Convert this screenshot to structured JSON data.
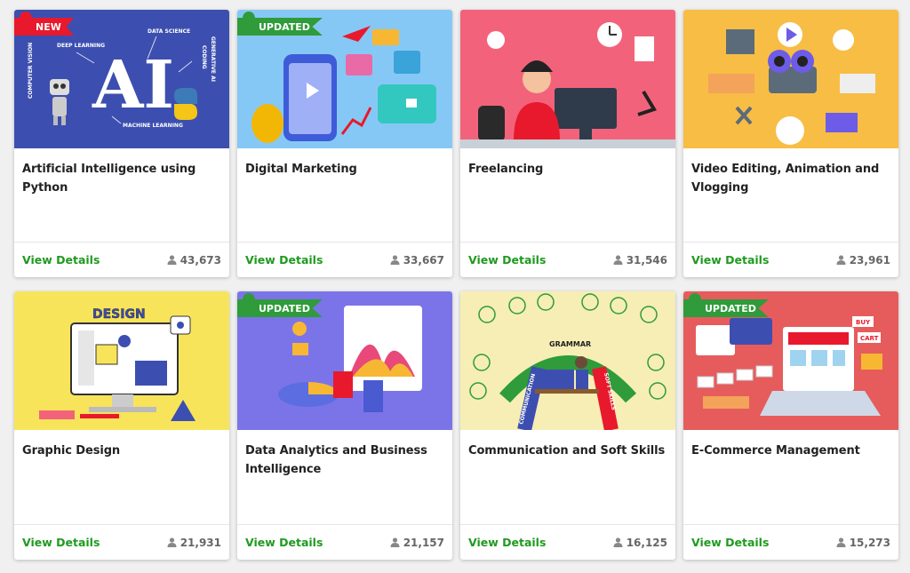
{
  "courses": [
    {
      "title": "Artificial Intelligence using Python",
      "details": "View Details",
      "count": "43,673",
      "badge": "NEW",
      "badge_color": "#e8192c",
      "thumb_bg": "#3c4fb0"
    },
    {
      "title": "Digital Marketing",
      "details": "View Details",
      "count": "33,667",
      "badge": "UPDATED",
      "badge_color": "#2f9b3a",
      "thumb_bg": "#86c8f5"
    },
    {
      "title": "Freelancing",
      "details": "View Details",
      "count": "31,546",
      "badge": "",
      "badge_color": "",
      "thumb_bg": "#f2637b"
    },
    {
      "title": "Video Editing, Animation and Vlogging",
      "details": "View Details",
      "count": "23,961",
      "badge": "",
      "badge_color": "",
      "thumb_bg": "#f7bd45"
    },
    {
      "title": "Graphic Design",
      "details": "View Details",
      "count": "21,931",
      "badge": "",
      "badge_color": "",
      "thumb_bg": "#f8e45a"
    },
    {
      "title": "Data Analytics and Business Intelligence",
      "details": "View Details",
      "count": "21,157",
      "badge": "UPDATED",
      "badge_color": "#2f9b3a",
      "thumb_bg": "#7b74e9"
    },
    {
      "title": "Communication and Soft Skills",
      "details": "View Details",
      "count": "16,125",
      "badge": "",
      "badge_color": "",
      "thumb_bg": "#f6eeb4"
    },
    {
      "title": "E-Commerce Management",
      "details": "View Details",
      "count": "15,273",
      "badge": "UPDATED",
      "badge_color": "#2f9b3a",
      "thumb_bg": "#e65c5c"
    }
  ],
  "thumb_text": {
    "ai_big": "AI",
    "ai_labels": [
      "DEEP LEARNING",
      "DATA SCIENCE",
      "CODING",
      "GENERATIVE AI",
      "COMPUTER VISION",
      "MACHINE LEARNING"
    ],
    "design": "DESIGN",
    "comm_labels": [
      "COMMUNICATION",
      "GRAMMAR",
      "SOFT SKILLS"
    ],
    "ecom_labels": [
      "BUY",
      "CART"
    ]
  }
}
